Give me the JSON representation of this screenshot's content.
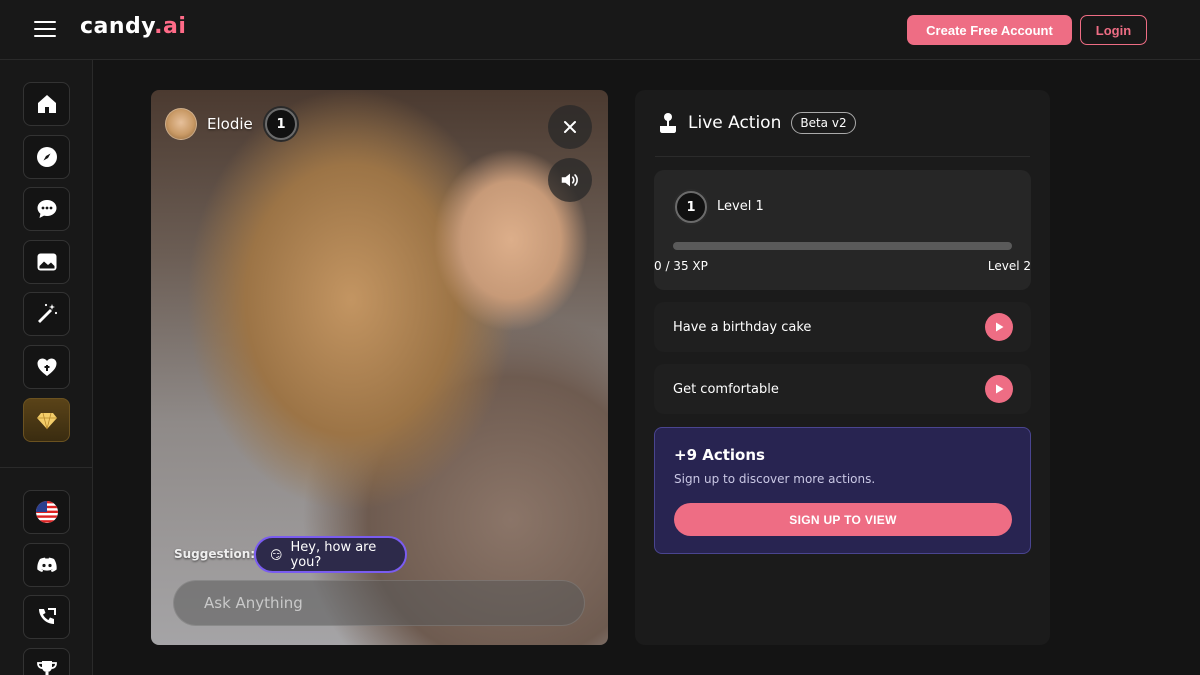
{
  "header": {
    "logo_main": "candy",
    "logo_accent": ".ai",
    "create_account_label": "Create Free Account",
    "login_label": "Login"
  },
  "sidebar": {
    "items": [
      {
        "name": "home",
        "icon": "home-icon"
      },
      {
        "name": "explore",
        "icon": "compass-icon"
      },
      {
        "name": "chat",
        "icon": "chat-bubble-icon"
      },
      {
        "name": "gallery",
        "icon": "image-icon"
      },
      {
        "name": "create",
        "icon": "magic-wand-icon"
      },
      {
        "name": "my-ai",
        "icon": "heart-icon"
      },
      {
        "name": "premium",
        "icon": "diamond-icon"
      }
    ],
    "bottom_items": [
      {
        "name": "language",
        "icon": "us-flag-icon"
      },
      {
        "name": "discord",
        "icon": "discord-icon"
      },
      {
        "name": "support",
        "icon": "support-icon"
      },
      {
        "name": "leaderboard",
        "icon": "trophy-icon"
      }
    ]
  },
  "video": {
    "character_name": "Elodie",
    "level": "1",
    "suggestion_label": "Suggestion:",
    "suggestion_text": "Hey, how are you?",
    "suggestion_emoji": "😏",
    "input_placeholder": "Ask Anything"
  },
  "live_action": {
    "title": "Live Action",
    "badge": "Beta v2",
    "level_badge": "1",
    "level_label": "Level 1",
    "xp_text": "0 / 35 XP",
    "xp_progress": 0,
    "next_level": "Level 2",
    "actions": [
      {
        "label": "Have a birthday cake"
      },
      {
        "label": "Get comfortable"
      }
    ],
    "more": {
      "title": "+9 Actions",
      "subtitle": "Sign up to discover more actions.",
      "button_label": "SIGN UP TO VIEW"
    }
  },
  "colors": {
    "accent": "#ee6d84",
    "background": "#141414",
    "panel": "#1b1b1b",
    "more_card": "#282451",
    "suggestion_border": "#7a5cf0"
  }
}
